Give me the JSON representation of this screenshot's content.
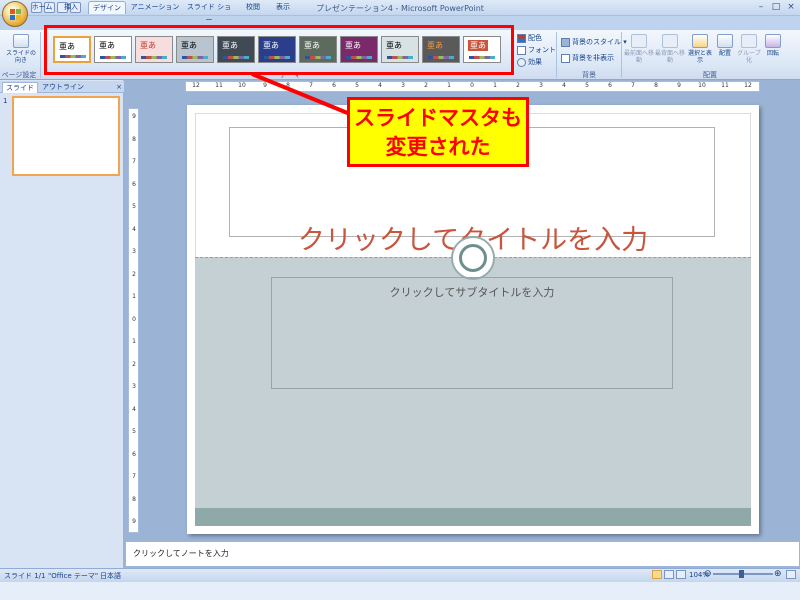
{
  "window": {
    "title": "プレゼンテーション4 - Microsoft PowerPoint"
  },
  "tabs": [
    {
      "label": "ホーム"
    },
    {
      "label": "挿入"
    },
    {
      "label": "デザイン"
    },
    {
      "label": "アニメーション"
    },
    {
      "label": "スライド ショー"
    },
    {
      "label": "校閲"
    },
    {
      "label": "表示"
    }
  ],
  "ribbon": {
    "page_setup": {
      "button": "スライドの向き",
      "group": "ページ設定"
    },
    "themes": {
      "group": "テーマ",
      "items": [
        {
          "text": "亜あ",
          "bg": "#ffffff",
          "fg": "#000000"
        },
        {
          "text": "亜あ",
          "bg": "#ffffff",
          "fg": "#000000"
        },
        {
          "text": "亜あ",
          "bg": "#f6dede",
          "fg": "#c0392b"
        },
        {
          "text": "亜あ",
          "bg": "#b8c4cf",
          "fg": "#000000"
        },
        {
          "text": "亜あ",
          "bg": "#3f4a55",
          "fg": "#ffffff"
        },
        {
          "text": "亜あ",
          "bg": "#2b3e8c",
          "fg": "#ffffff"
        },
        {
          "text": "亜あ",
          "bg": "#5d6b5e",
          "fg": "#ffffff"
        },
        {
          "text": "亜あ",
          "bg": "#7a2a6a",
          "fg": "#ffffff"
        },
        {
          "text": "亜あ",
          "bg": "#d7e2e4",
          "fg": "#000000"
        },
        {
          "text": "亜あ",
          "bg": "#5a5a5a",
          "fg": "#ff9933"
        },
        {
          "text": "亜あ",
          "bg": "#ffffff",
          "fg": "#ffffff"
        }
      ],
      "right": {
        "colors": "配色",
        "fonts": "フォント",
        "effects": "効果"
      }
    },
    "background": {
      "style": "背景のスタイル",
      "hide": "背景を非表示",
      "group": "背景"
    },
    "arrange": {
      "group": "配置",
      "bring_front": "最前面へ移動",
      "send_back": "最背面へ移動",
      "selection": "選択と表示",
      "align": "配置",
      "group_btn": "グループ化",
      "rotate": "回転"
    }
  },
  "callout": {
    "line1": "スライドマスタも",
    "line2": "変更された"
  },
  "panel": {
    "tab_slides": "スライド",
    "tab_outline": "アウトライン",
    "thumb_number": "1",
    "close": "×"
  },
  "slide": {
    "title": "クリックしてタイトルを入力",
    "subtitle": "クリックしてサブタイトルを入力"
  },
  "notes": {
    "placeholder": "クリックしてノートを入力"
  },
  "status": {
    "slide": "スライド 1/1",
    "theme": "\"Office テーマ\"",
    "language": "日本語",
    "zoom": "104%"
  },
  "ruler": {
    "h_ticks": [
      "12",
      "11",
      "10",
      "9",
      "8",
      "7",
      "6",
      "5",
      "4",
      "3",
      "2",
      "1",
      "0",
      "1",
      "2",
      "3",
      "4",
      "5",
      "6",
      "7",
      "8",
      "9",
      "10",
      "11",
      "12"
    ],
    "v_ticks": [
      "9",
      "8",
      "7",
      "6",
      "5",
      "4",
      "3",
      "2",
      "1",
      "0",
      "1",
      "2",
      "3",
      "4",
      "5",
      "6",
      "7",
      "8",
      "9"
    ]
  }
}
